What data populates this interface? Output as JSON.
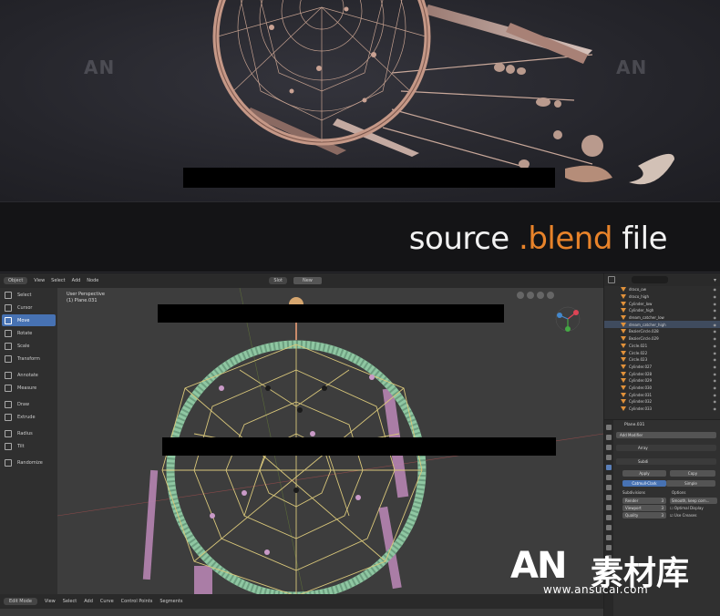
{
  "banner": {
    "prefix": "source ",
    "accent": ".blend",
    "suffix": " file"
  },
  "watermark": {
    "mark": "AN",
    "chinese": "素材库",
    "url": "www.ansucai.com"
  },
  "header": {
    "editor": "Object",
    "menus": [
      "View",
      "Select",
      "Add",
      "Node"
    ],
    "shading": "Slot",
    "new_button": "New"
  },
  "toolbar": {
    "tools": [
      "Select",
      "Cursor",
      "Move",
      "Rotate",
      "Scale",
      "Transform",
      "Annotate",
      "Measure",
      "Draw",
      "Extrude",
      "Radius",
      "Tilt",
      "Randomize"
    ],
    "active": "Move"
  },
  "viewport": {
    "view_label": "User Perspective",
    "object_label": "(1) Plane.031"
  },
  "statusbar": {
    "mode": "Edit Mode",
    "menus": [
      "View",
      "Select",
      "Add",
      "Curve",
      "Control Points",
      "Segments"
    ]
  },
  "outliner": {
    "items": [
      "draco_ow",
      "draco_high",
      "Cylinder_low",
      "Cylinder_high",
      "dream_catcher_low",
      "dream_catcher_high",
      "BezierCircle.028",
      "BezierCircle.029",
      "Circle.021",
      "Circle.022",
      "Circle.023",
      "Cylinder.027",
      "Cylinder.028",
      "Cylinder.029",
      "Cylinder.030",
      "Cylinder.031",
      "Cylinder.032",
      "Cylinder.033"
    ],
    "highlighted": "dream_catcher_high"
  },
  "properties": {
    "object": "Plane.031",
    "add_modifier": "Add Modifier",
    "modifier1": "Array",
    "modifier2": "Subdi",
    "apply": "Apply",
    "copy": "Copy",
    "catmull": "Catmull-Clark",
    "simple": "Simple",
    "subdivisions": "Subdivisions",
    "options": "Options",
    "render_label": "Render",
    "render_val": "3",
    "viewport_label": "Viewport",
    "viewport_val": "3",
    "quality_label": "Quality",
    "quality_val": "3",
    "smooth": "Smooth, keep corn...",
    "optimal": "Optimal Display",
    "creases": "Use Creases"
  },
  "colors": {
    "accent": "#e8832a",
    "active_tool": "#4772b3",
    "ring_green": "#8fc7a2",
    "web_yellow": "#d9c77a",
    "feather_pink": "#b785b3"
  }
}
